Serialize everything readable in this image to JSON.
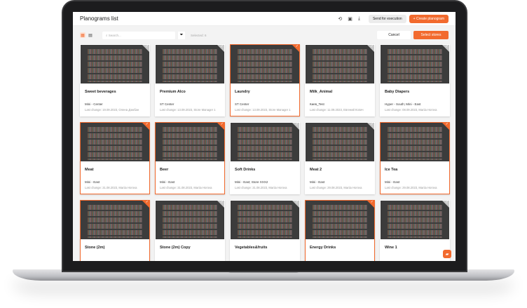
{
  "header": {
    "title": "Planograms list",
    "send_label": "Send for execution",
    "create_label": "+ Create planogram"
  },
  "toolbar": {
    "search_placeholder": "Search...",
    "selected": "Selected: 6",
    "cancel": "Cancel",
    "select_stores": "Select stores"
  },
  "accent": "#f26a2e",
  "cards": [
    {
      "name": "Sweet beverages",
      "store": "Mini - Center",
      "last": "Last change: 19.09.2023, Олена Дзюбан",
      "selected": false
    },
    {
      "name": "Premium Alco",
      "store": "ST Center",
      "last": "Last change: 13.09.2023, Store Manager 1",
      "selected": false
    },
    {
      "name": "Laundry",
      "store": "ST Center",
      "last": "Last change: 13.09.2023, Store Manager 1",
      "selected": true
    },
    {
      "name": "Milk_Animal",
      "store": "Киев_Test",
      "last": "Last change: 11.09.2023, Евгений Копич",
      "selected": false
    },
    {
      "name": "Baby Diapers",
      "store": "Hyper - South; Mini - East",
      "last": "Last change: 08.09.2023, Mariia Horova",
      "selected": false
    },
    {
      "name": "Meat",
      "store": "Mini - East",
      "last": "Last change: 31.08.2023, Mariia Horova",
      "selected": true
    },
    {
      "name": "Beer",
      "store": "Mini - East",
      "last": "Last change: 31.08.2023, Mariia Horova",
      "selected": true
    },
    {
      "name": "Soft Drinks",
      "store": "Mini - East; Store XXX2",
      "last": "Last change: 31.08.2023, Mariia Horova",
      "selected": false
    },
    {
      "name": "Meat 2",
      "store": "Mini - East",
      "last": "Last change: 29.08.2023, Mariia Horova",
      "selected": false
    },
    {
      "name": "Ice Tea",
      "store": "Mini - East",
      "last": "Last change: 29.08.2023, Mariia Horova",
      "selected": true
    },
    {
      "name": "Stone (2m)",
      "store": "",
      "last": "",
      "selected": true
    },
    {
      "name": "Stone (2m) Copy",
      "store": "",
      "last": "",
      "selected": false
    },
    {
      "name": "Vegetables&fruits",
      "store": "",
      "last": "",
      "selected": false
    },
    {
      "name": "Energy Drinks",
      "store": "",
      "last": "",
      "selected": true
    },
    {
      "name": "Wine 1",
      "store": "",
      "last": "",
      "selected": false
    }
  ]
}
